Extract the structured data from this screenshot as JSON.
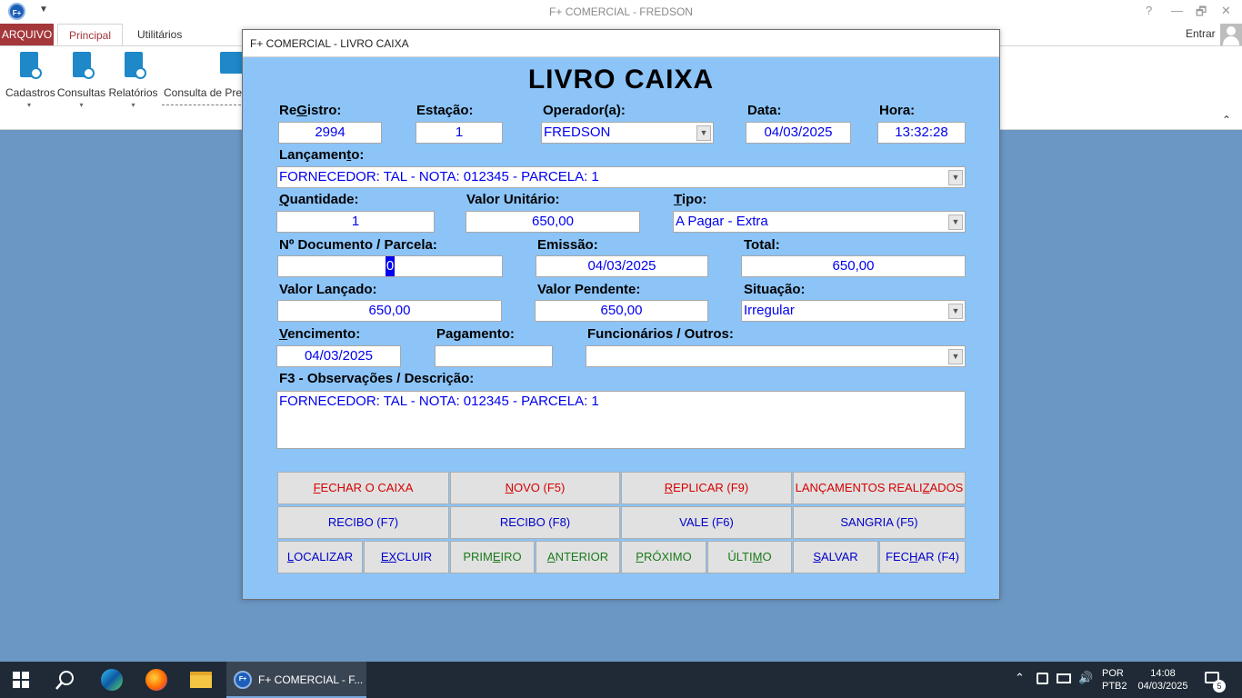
{
  "app": {
    "logo": "F+",
    "title": "F+ COMERCIAL - FREDSON",
    "help": "?",
    "minimize": "—",
    "restore": "🗗",
    "close": "✕",
    "quick_access": "▼"
  },
  "tabs": {
    "arquivo": "ARQUIVO",
    "principal": "Principal",
    "utilitarios": "Utilitários",
    "entrar": "Entrar"
  },
  "ribbon": {
    "cadastros": "Cadastros",
    "consultas": "Consultas",
    "relatorios": "Relatórios",
    "consulta_preco": "Consulta de Prec",
    "caret": "▾",
    "collapse": "⌃"
  },
  "dialog": {
    "title": "F+ COMERCIAL - LIVRO CAIXA",
    "heading": "LIVRO CAIXA",
    "labels": {
      "registro_a": "Re",
      "registro_b": "G",
      "registro_c": "istro:",
      "estacao": "Estação:",
      "operador": "Operador(a):",
      "data": "Data:",
      "hora": "Hora:",
      "lancamento_a": "Lançamen",
      "lancamento_b": "t",
      "lancamento_c": "o:",
      "quantidade_a": "Q",
      "quantidade_b": "uantidade:",
      "valor_unitario": "Valor Unitário:",
      "tipo_a": "T",
      "tipo_b": "ipo:",
      "documento": "Nº Documento / Parcela:",
      "emissao": "Emissão:",
      "total": "Total:",
      "valor_lancado": "Valor Lançado:",
      "valor_pendente": "Valor Pendente:",
      "situacao": "Situação:",
      "vencimento_a": "V",
      "vencimento_b": "encimento:",
      "pagamento": "Pagamento:",
      "funcionarios": "Funcionários / Outros:",
      "observacoes": "F3 - Observações / Descrição:"
    },
    "values": {
      "registro": "2994",
      "estacao": "1",
      "operador": "FREDSON",
      "data": "04/03/2025",
      "hora": "13:32:28",
      "lancamento": "FORNECEDOR: TAL - NOTA: 012345 - PARCELA: 1",
      "quantidade": "1",
      "valor_unitario": "650,00",
      "tipo": "A Pagar - Extra",
      "documento": "0",
      "emissao": "04/03/2025",
      "total": "650,00",
      "valor_lancado": "650,00",
      "valor_pendente": "650,00",
      "situacao": "Irregular",
      "vencimento": "04/03/2025",
      "pagamento": "",
      "funcionarios": "",
      "observacoes": "FORNECEDOR: TAL - NOTA: 012345 - PARCELA: 1"
    },
    "dropdown_arrow": "▼",
    "buttons": {
      "fechar_caixa_a": "F",
      "fechar_caixa_b": "ECHAR O CAIXA",
      "novo_a": "N",
      "novo_b": "OVO (F5)",
      "replicar_a": "R",
      "replicar_b": "EPLICAR (F9)",
      "lancamentos_a": "LANÇAMENTOS REALI",
      "lancamentos_b": "Z",
      "lancamentos_c": "ADOS",
      "recibo_f7": "RECIBO (F7)",
      "recibo_f8": "RECIBO (F8)",
      "vale": "VALE (F6)",
      "sangria": "SANGRIA (F5)",
      "localizar_a": "L",
      "localizar_b": "OCALIZAR",
      "excluir_a": "EX",
      "excluir_b": "CLUIR",
      "primeiro_a": "PRIM",
      "primeiro_b": "E",
      "primeiro_c": "IRO",
      "anterior_a": "A",
      "anterior_b": "NTERIOR",
      "proximo_a": "P",
      "proximo_b": "RÓXIMO",
      "ultimo_a": "ÚLTI",
      "ultimo_b": "M",
      "ultimo_c": "O",
      "salvar_a": "S",
      "salvar_b": "ALVAR",
      "fechar_a": "FEC",
      "fechar_b": "H",
      "fechar_c": "AR (F4)"
    }
  },
  "taskbar": {
    "app_logo": "F+",
    "app_label": "F+ COMERCIAL - F...",
    "lang1": "POR",
    "lang2": "PTB2",
    "time": "14:08",
    "date": "04/03/2025",
    "notifications": "5"
  }
}
